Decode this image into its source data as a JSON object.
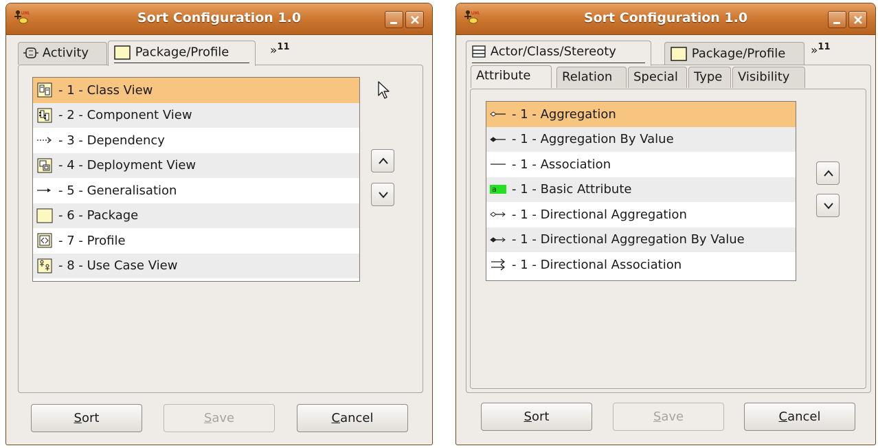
{
  "left": {
    "title": "Sort Configuration 1.0",
    "tabs": [
      {
        "label": "Activity",
        "icon": "activity-icon"
      },
      {
        "label": "Package/Profile",
        "icon": "package-icon"
      }
    ],
    "more_tabs": {
      "arrows": "»",
      "count": "11"
    },
    "items": [
      {
        "label": "- 1 - Class View",
        "icon": "class-view-icon"
      },
      {
        "label": "- 2 - Component View",
        "icon": "component-view-icon"
      },
      {
        "label": "- 3 - Dependency",
        "icon": "dependency-arrow-icon"
      },
      {
        "label": "- 4 - Deployment View",
        "icon": "deployment-view-icon"
      },
      {
        "label": "- 5 - Generalisation",
        "icon": "generalisation-arrow-icon"
      },
      {
        "label": "- 6 - Package",
        "icon": "package-icon"
      },
      {
        "label": "- 7 - Profile",
        "icon": "profile-icon"
      },
      {
        "label": "- 8 - Use Case View",
        "icon": "use-case-view-icon"
      }
    ],
    "buttons": {
      "sort": {
        "mnemonic": "S",
        "rest": "ort"
      },
      "save": {
        "mnemonic": "S",
        "rest": "ave"
      },
      "cancel": {
        "mnemonic": "C",
        "rest": "ancel"
      }
    }
  },
  "right": {
    "title": "Sort Configuration 1.0",
    "tabs": [
      {
        "label": "Actor/Class/Stereoty",
        "icon": "class-icon"
      },
      {
        "label": "Package/Profile",
        "icon": "package-icon"
      }
    ],
    "more_tabs": {
      "arrows": "»",
      "count": "11"
    },
    "subtabs": [
      "Attribute",
      "Relation",
      "Special",
      "Type",
      "Visibility"
    ],
    "items": [
      {
        "label": "- 1 - Aggregation",
        "icon": "aggregation-icon"
      },
      {
        "label": "- 1 - Aggregation By Value",
        "icon": "composition-icon"
      },
      {
        "label": "- 1 - Association",
        "icon": "association-icon"
      },
      {
        "label": "- 1 - Basic Attribute",
        "icon": "basic-attribute-icon",
        "icon_text": "a"
      },
      {
        "label": "- 1 - Directional Aggregation",
        "icon": "directional-aggregation-icon"
      },
      {
        "label": "- 1 - Directional Aggregation By Value",
        "icon": "directional-composition-icon"
      },
      {
        "label": "- 1 - Directional Association",
        "icon": "directional-association-icon"
      }
    ],
    "buttons": {
      "sort": {
        "mnemonic": "S",
        "rest": "ort"
      },
      "save": {
        "mnemonic": "S",
        "rest": "ave"
      },
      "cancel": {
        "mnemonic": "C",
        "rest": "ancel"
      }
    }
  },
  "colors": {
    "titlebar": "#cf7a32",
    "selection": "#f7c580",
    "window_bg": "#efebe7",
    "basic_attribute_green": "#22e022"
  }
}
